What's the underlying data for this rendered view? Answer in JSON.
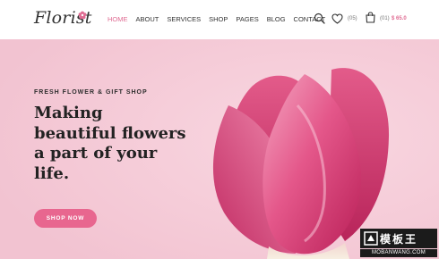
{
  "brand": {
    "logo_text": "Florist"
  },
  "nav": {
    "items": [
      {
        "label": "HOME",
        "active": true
      },
      {
        "label": "ABOUT",
        "active": false
      },
      {
        "label": "SERVICES",
        "active": false
      },
      {
        "label": "SHOP",
        "active": false
      },
      {
        "label": "PAGES",
        "active": false
      },
      {
        "label": "BLOG",
        "active": false
      },
      {
        "label": "CONTACT",
        "active": false
      }
    ]
  },
  "header_actions": {
    "search_icon": "search-icon",
    "wishlist_icon": "heart-icon",
    "wishlist_count": "(05)",
    "cart_icon": "shopping-bag-icon",
    "cart_count": "(01)",
    "cart_total": "$ 65.0"
  },
  "hero": {
    "eyebrow": "FRESH FLOWER & GIFT SHOP",
    "headline_line1": "Making",
    "headline_line2": "beautiful flowers",
    "headline_line3": "a part of your",
    "headline_line4": "life.",
    "button_label": "SHOP NOW"
  },
  "watermark": {
    "cn_text": "模板王",
    "url_text": "MOBANWANG.COM"
  },
  "colors": {
    "accent": "#e06c93",
    "hero_background": "#f5cbd7",
    "button": "#e8668f",
    "text_dark": "#222222"
  }
}
